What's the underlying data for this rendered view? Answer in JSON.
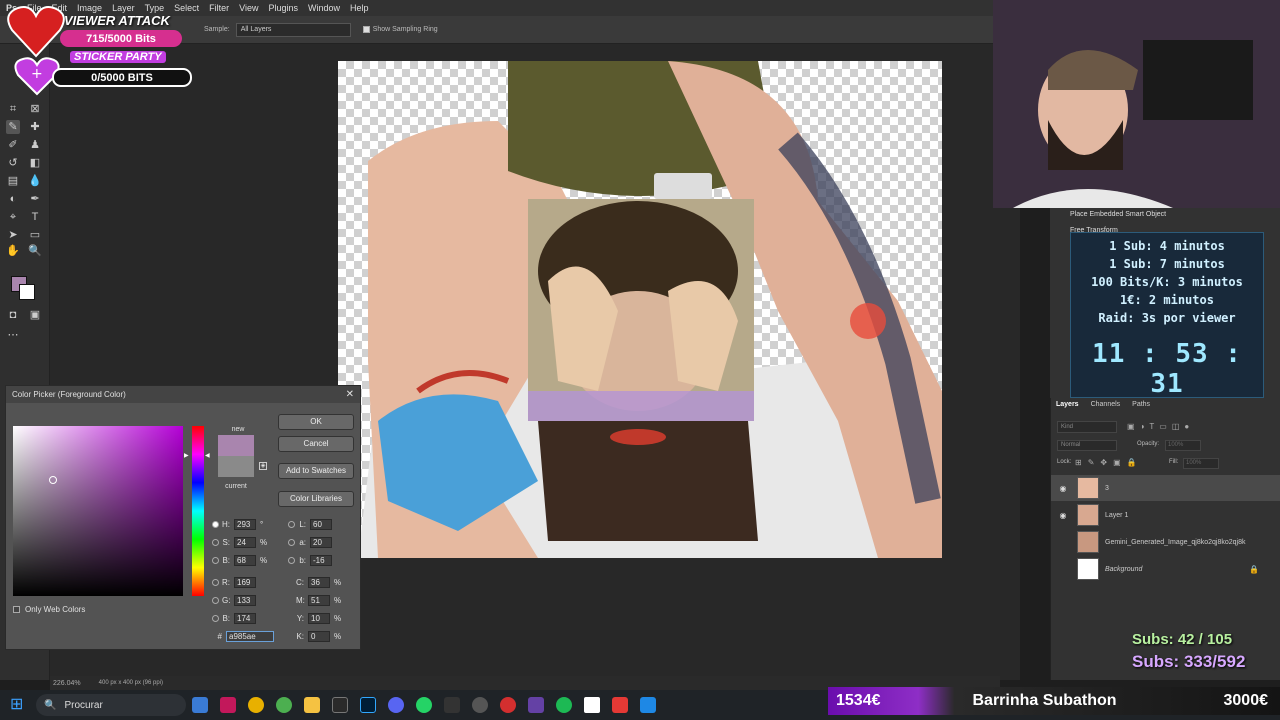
{
  "menubar": {
    "items": [
      "File",
      "Edit",
      "Image",
      "Layer",
      "Type",
      "Select",
      "Filter",
      "View",
      "Plugins",
      "Window",
      "Help"
    ]
  },
  "options_bar": {
    "sample_label": "Sample:",
    "sample_value": "All Layers",
    "sampling_ring": "Show Sampling Ring"
  },
  "stream_overlay": {
    "viewer_attack": "VIEWER ATTACK",
    "bits_progress": "715/5000 Bits",
    "sticker_party": "STICKER PARTY",
    "bits_progress_2": "0/5000 BITS",
    "timer_lines": [
      "1 Sub: 4 minutos",
      "1 Sub: 7 minutos",
      "100 Bits/K: 3 minutos",
      "1€: 2 minutos",
      "Raid: 3s por viewer"
    ],
    "timer_clock": "11 : 53 : 31",
    "subs_1": "Subs: 42 / 105",
    "subs_2": "Subs: 333/592",
    "bar_left": "1534€",
    "bar_title": "Barrinha Subathon",
    "bar_right": "3000€"
  },
  "color_picker": {
    "title": "Color Picker (Foreground Color)",
    "ok": "OK",
    "cancel": "Cancel",
    "add_to_swatches": "Add to Swatches",
    "color_libraries": "Color Libraries",
    "new_label": "new",
    "current_label": "current",
    "only_web_colors": "Only Web Colors",
    "hsb": {
      "H": "293",
      "S": "24",
      "B": "68"
    },
    "rgb": {
      "R": "169",
      "G": "133",
      "B": "174"
    },
    "lab": {
      "L": "60",
      "a": "20",
      "b": "-16"
    },
    "cmyk": {
      "C": "36",
      "M": "51",
      "Y": "10",
      "K": "0"
    },
    "hex": "a985ae",
    "units": {
      "deg": "°",
      "pct": "%"
    },
    "colors": {
      "new": "#a985ae",
      "current": "#8a8a8a",
      "hue": "#b400d6"
    }
  },
  "history": {
    "items": [
      "Place Embedded Smart Object",
      "Free Transform"
    ]
  },
  "layers_panel": {
    "tabs": [
      "Layers",
      "Channels",
      "Paths"
    ],
    "search_placeholder": "Kind",
    "blend_mode": "Normal",
    "opacity_label": "Opacity:",
    "opacity_value": "100%",
    "lock_label": "Lock:",
    "fill_label": "Fill:",
    "fill_value": "100%",
    "layers": [
      {
        "name": "3",
        "visible": true,
        "selected": true
      },
      {
        "name": "Layer 1",
        "visible": true,
        "selected": false
      },
      {
        "name": "Gemini_Generated_Image_qj8ko2qj8ko2qj8k",
        "visible": false,
        "selected": false
      },
      {
        "name": "Background",
        "visible": false,
        "selected": false,
        "locked": true
      }
    ]
  },
  "status_bar": {
    "zoom": "226.04%",
    "doc_info": "400 px x 400 px (96 ppi)"
  },
  "taskbar": {
    "search": "Procurar"
  }
}
